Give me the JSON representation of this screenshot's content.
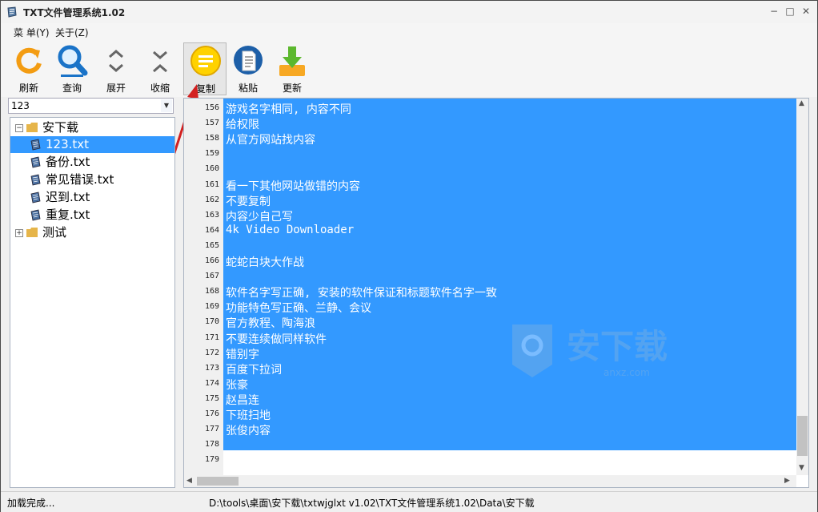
{
  "window": {
    "title": "TXT文件管理系统1.02",
    "controls": [
      "−",
      "□",
      "✕"
    ]
  },
  "menubar": {
    "items": [
      "菜 单(Y)",
      "关于(Z)"
    ]
  },
  "toolbar": {
    "refresh_label": "刷新",
    "search_label": "查询",
    "expand_label": "展开",
    "collapse_label": "收缩",
    "copy_label": "复制",
    "paste_label": "粘贴",
    "update_label": "更新"
  },
  "search_combo": {
    "value": "123"
  },
  "tree": {
    "root1": {
      "label": "安下载",
      "expander": "−"
    },
    "files": [
      "123.txt",
      "备份.txt",
      "常见错误.txt",
      "迟到.txt",
      "重复.txt"
    ],
    "root2": {
      "label": "测试",
      "expander": "+"
    }
  },
  "editor": {
    "lines": [
      {
        "num": "156",
        "text": "游戏名字相同, 内容不同"
      },
      {
        "num": "157",
        "text": "给权限"
      },
      {
        "num": "158",
        "text": "从官方网站找内容"
      },
      {
        "num": "159",
        "text": ""
      },
      {
        "num": "160",
        "text": ""
      },
      {
        "num": "161",
        "text": "看一下其他网站做错的内容"
      },
      {
        "num": "162",
        "text": "不要复制"
      },
      {
        "num": "163",
        "text": "内容少自己写"
      },
      {
        "num": "164",
        "text": "4k Video Downloader"
      },
      {
        "num": "165",
        "text": ""
      },
      {
        "num": "166",
        "text": "蛇蛇白块大作战"
      },
      {
        "num": "167",
        "text": ""
      },
      {
        "num": "168",
        "text": "软件名字写正确, 安装的软件保证和标题软件名字一致"
      },
      {
        "num": "169",
        "text": "功能特色写正确、兰静、会议"
      },
      {
        "num": "170",
        "text": "官方教程、陶海浪"
      },
      {
        "num": "171",
        "text": "不要连续做同样软件"
      },
      {
        "num": "172",
        "text": "错别字"
      },
      {
        "num": "173",
        "text": "百度下拉词"
      },
      {
        "num": "174",
        "text": "张豪"
      },
      {
        "num": "175",
        "text": "赵昌连"
      },
      {
        "num": "176",
        "text": "下班扫地"
      },
      {
        "num": "177",
        "text": "张俊内容"
      },
      {
        "num": "178",
        "text": ""
      },
      {
        "num": "179",
        "text": ""
      }
    ]
  },
  "statusbar": {
    "status": "加载完成...",
    "path": "D:\\tools\\桌面\\安下载\\txtwjglxt v1.02\\TXT文件管理系统1.02\\Data\\安下载"
  },
  "watermark": {
    "text": "安下载",
    "subtext": "anxz.com"
  },
  "colors": {
    "selection": "#3399ff",
    "accent_arrow": "#d32020"
  }
}
